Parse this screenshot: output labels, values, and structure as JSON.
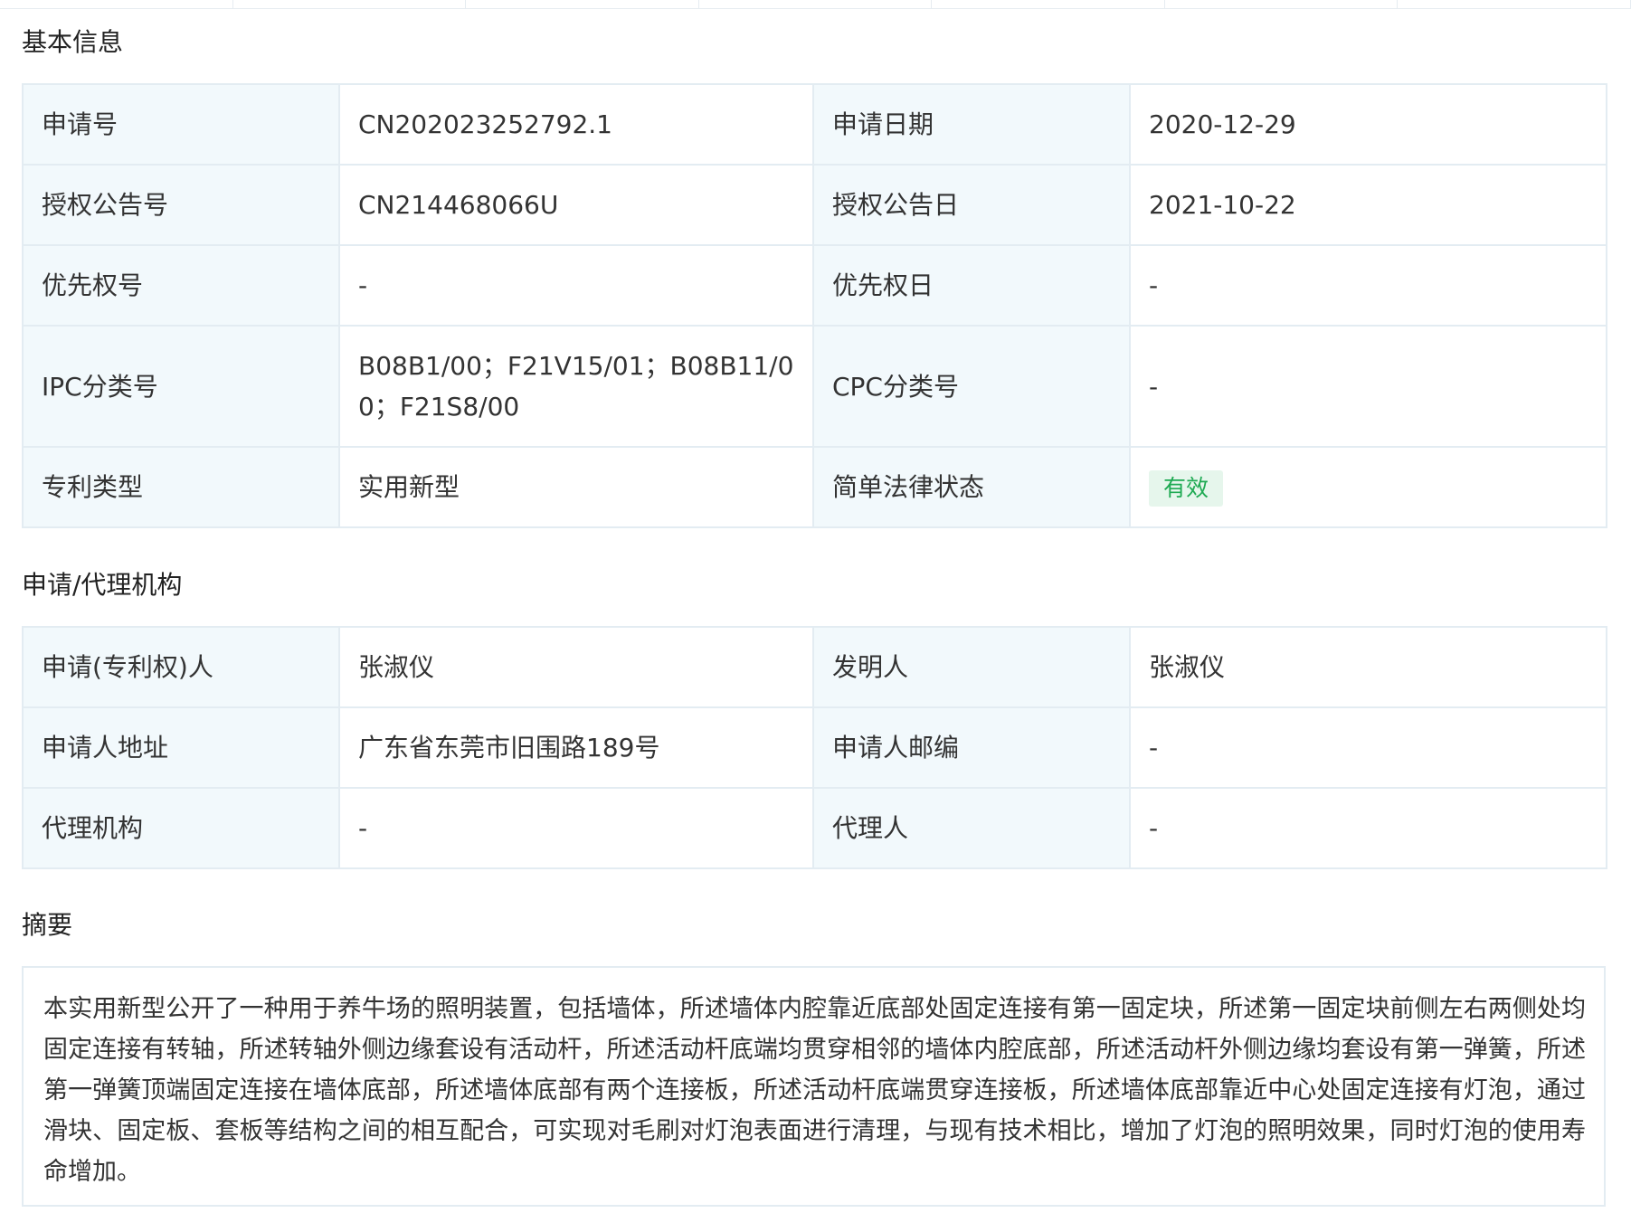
{
  "sections": {
    "basic_info": "基本信息",
    "applicant_agency": "申请/代理机构",
    "abstract": "摘要"
  },
  "basic_info": {
    "application_number": {
      "label": "申请号",
      "value": "CN202023252792.1"
    },
    "application_date": {
      "label": "申请日期",
      "value": "2020-12-29"
    },
    "grant_number": {
      "label": "授权公告号",
      "value": "CN214468066U"
    },
    "grant_date": {
      "label": "授权公告日",
      "value": "2021-10-22"
    },
    "priority_number": {
      "label": "优先权号",
      "value": "-"
    },
    "priority_date": {
      "label": "优先权日",
      "value": "-"
    },
    "ipc": {
      "label": "IPC分类号",
      "value_line1": "B08B1/00；F21V15/01；B08B11/0",
      "value_line2": "0；F21S8/00"
    },
    "cpc": {
      "label": "CPC分类号",
      "value": "-"
    },
    "patent_type": {
      "label": "专利类型",
      "value": "实用新型"
    },
    "legal_status": {
      "label": "简单法律状态",
      "value": "有效"
    }
  },
  "applicant": {
    "applicant": {
      "label": "申请(专利权)人",
      "value": "张淑仪"
    },
    "inventor": {
      "label": "发明人",
      "value": "张淑仪"
    },
    "address": {
      "label": "申请人地址",
      "value": "广东省东莞市旧围路189号"
    },
    "postcode": {
      "label": "申请人邮编",
      "value": "-"
    },
    "agency": {
      "label": "代理机构",
      "value": "-"
    },
    "agent": {
      "label": "代理人",
      "value": "-"
    }
  },
  "abstract_text": "本实用新型公开了一种用于养牛场的照明装置，包括墙体，所述墙体内腔靠近底部处固定连接有第一固定块，所述第一固定块前侧左右两侧处均固定连接有转轴，所述转轴外侧边缘套设有活动杆，所述活动杆底端均贯穿相邻的墙体内腔底部，所述活动杆外侧边缘均套设有第一弹簧，所述第一弹簧顶端固定连接在墙体底部，所述墙体底部有两个连接板，所述活动杆底端贯穿连接板，所述墙体底部靠近中心处固定连接有灯泡，通过滑块、固定板、套板等结构之间的相互配合，可实现对毛刷对灯泡表面进行清理，与现有技术相比，增加了灯泡的照明效果，同时灯泡的使用寿命增加。",
  "colors": {
    "label_bg": "#f2f9fc",
    "border": "#e3ecf2",
    "status_bg": "#e6f6ec",
    "status_text": "#1faa53"
  }
}
